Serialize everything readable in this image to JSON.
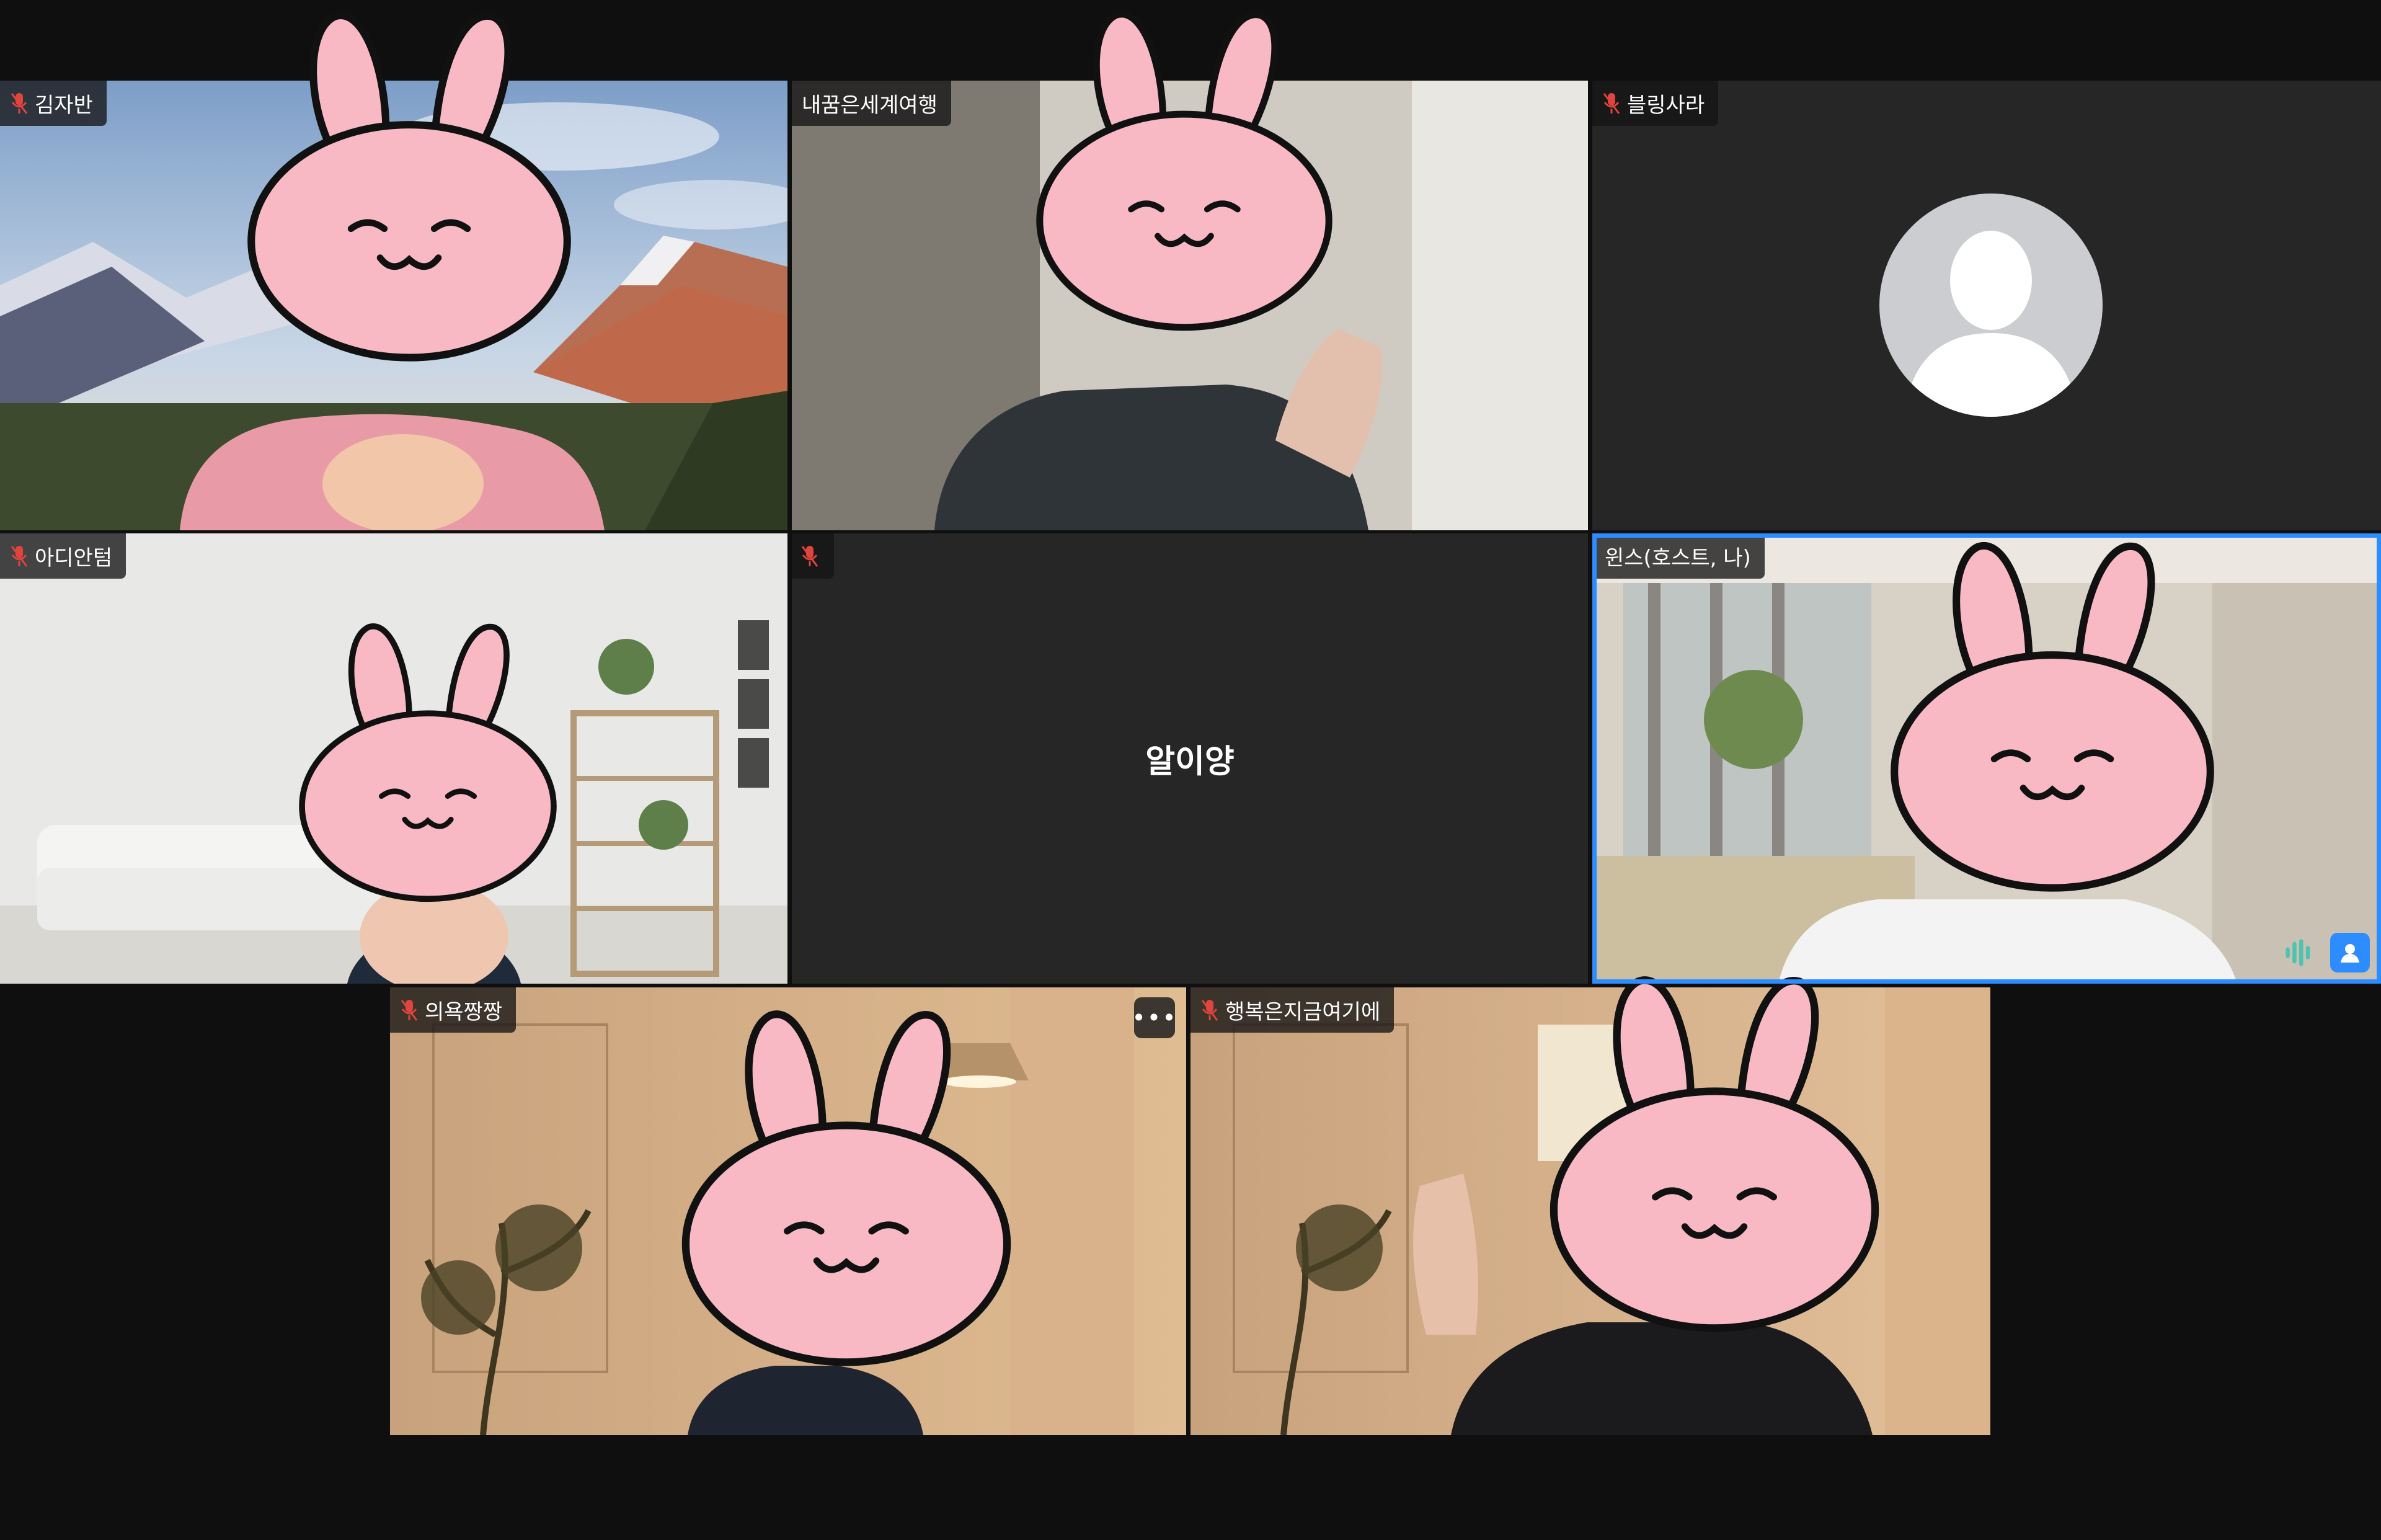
{
  "colors": {
    "background": "#0f0f0f",
    "tile_empty": "#262626",
    "active_border": "#2d8cff",
    "bunny_fill": "#f8b8c4",
    "mic_muted": "#e0443e"
  },
  "participants": [
    {
      "name": "김자반",
      "muted": true,
      "video": "mountain-background"
    },
    {
      "name": "내꿈은세계여행",
      "muted": false,
      "video": "room"
    },
    {
      "name": "블링사라",
      "muted": true,
      "video": "off-avatar"
    },
    {
      "name": "아디안텀",
      "muted": true,
      "video": "living-room"
    },
    {
      "name": "",
      "muted": true,
      "video": "off",
      "display_name": "알이양"
    },
    {
      "name": "윈스(호스트, 나)",
      "muted": false,
      "video": "lobby",
      "active_speaker": true
    },
    {
      "name": "의욕짱짱",
      "muted": true,
      "video": "warm-room"
    },
    {
      "name": "행복은지금여기에",
      "muted": true,
      "video": "warm-room"
    }
  ],
  "icons": {
    "mic_muted": "mic-muted-icon",
    "more": "more-options-icon",
    "audio_level": "audio-level-icon",
    "participant": "participant-icon",
    "avatar": "default-avatar-icon"
  },
  "more_glyph": "•••"
}
